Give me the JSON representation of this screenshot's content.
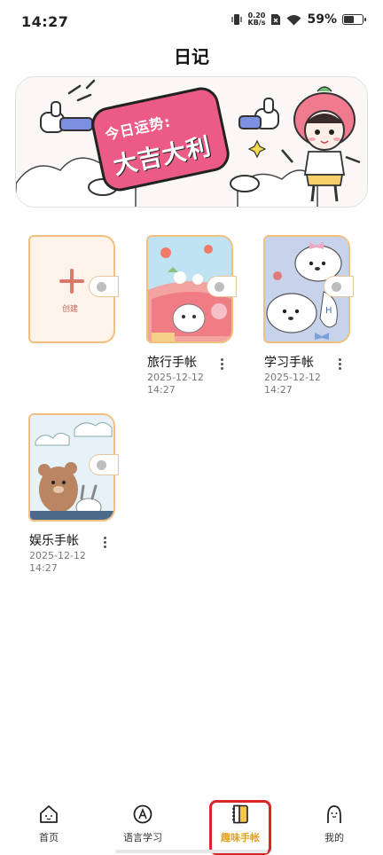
{
  "status_bar": {
    "time": "14:27",
    "net_speed_value": "0.20",
    "net_speed_unit": "KB/s",
    "battery": "59%",
    "battery_level": 0.59
  },
  "page": {
    "title": "日记"
  },
  "banner": {
    "line1": "今日运势:",
    "line2": "大吉大利"
  },
  "notebooks": {
    "create": {
      "label": "创建"
    },
    "items": [
      {
        "name": "旅行手帐",
        "date": "2025-12-12",
        "time": "14:27"
      },
      {
        "name": "学习手帐",
        "date": "2025-12-12",
        "time": "14:27"
      },
      {
        "name": "娱乐手帐",
        "date": "2025-12-12",
        "time": "14:27"
      }
    ]
  },
  "bottom_nav": {
    "items": [
      {
        "label": "首页",
        "icon": "home-icon"
      },
      {
        "label": "语言学习",
        "icon": "language-icon"
      },
      {
        "label": "趣味手帐",
        "icon": "notebook-icon"
      },
      {
        "label": "我的",
        "icon": "profile-icon"
      }
    ],
    "active_index": 2,
    "accent": "#e0a020",
    "highlight_color": "#d9262a"
  }
}
